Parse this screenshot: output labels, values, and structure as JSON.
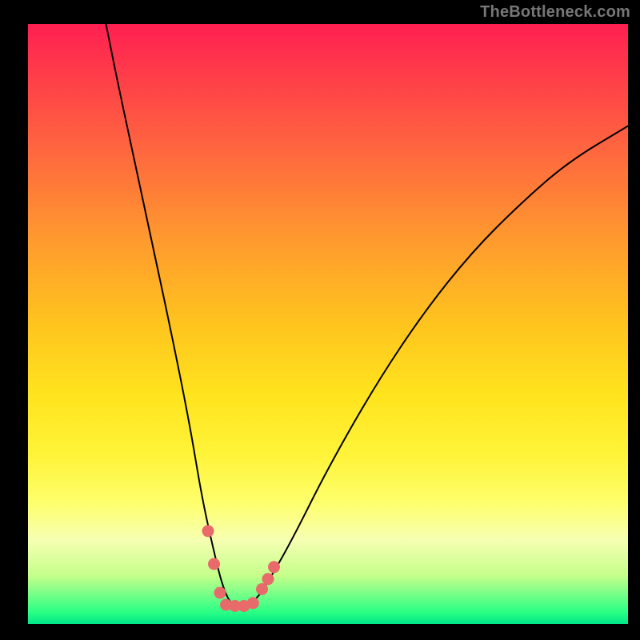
{
  "watermark": "TheBottleneck.com",
  "chart_data": {
    "type": "line",
    "title": "",
    "xlabel": "",
    "ylabel": "",
    "xlim": [
      0,
      100
    ],
    "ylim": [
      0,
      100
    ],
    "series": [
      {
        "name": "curve",
        "x": [
          13,
          15,
          18,
          21,
          24,
          27,
          29,
          31,
          32.5,
          34,
          36,
          38,
          40,
          44,
          50,
          58,
          66,
          74,
          82,
          90,
          100
        ],
        "values": [
          100,
          90,
          76,
          62,
          48,
          33,
          21,
          12,
          6,
          3,
          3,
          4,
          7,
          14,
          26,
          40,
          52,
          62,
          70,
          77,
          83
        ]
      }
    ],
    "markers": [
      {
        "x": 30.0,
        "y": 15.5
      },
      {
        "x": 31.0,
        "y": 10.0
      },
      {
        "x": 32.0,
        "y": 5.2
      },
      {
        "x": 33.0,
        "y": 3.2
      },
      {
        "x": 34.5,
        "y": 3.0
      },
      {
        "x": 36.0,
        "y": 3.0
      },
      {
        "x": 37.5,
        "y": 3.5
      },
      {
        "x": 39.0,
        "y": 5.8
      },
      {
        "x": 40.0,
        "y": 7.5
      },
      {
        "x": 41.0,
        "y": 9.5
      }
    ],
    "marker_color": "#e86a6a",
    "curve_color": "#000000",
    "grid": false
  }
}
